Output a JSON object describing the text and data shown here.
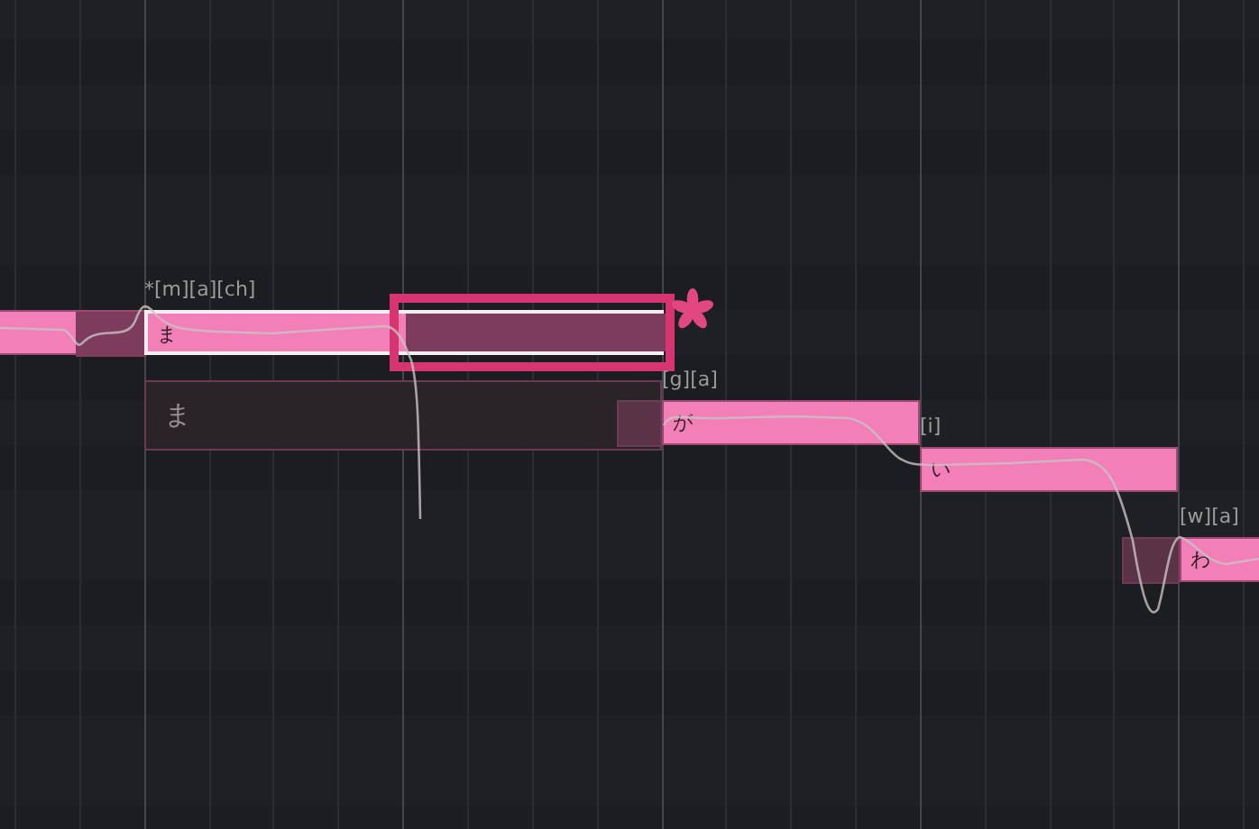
{
  "notes": [
    {
      "selected": false
    },
    {
      "lyric": "ま",
      "phonemes": "*[m][a][ch]",
      "selected": true
    },
    {
      "lyric": "が",
      "phonemes": "[g][a]",
      "selected": false
    },
    {
      "lyric": "い",
      "phonemes": "[i]",
      "selected": false
    },
    {
      "lyric": "わ",
      "phonemes": "[w][a]",
      "selected": false
    }
  ],
  "ghost_note": {
    "lyric": "ま"
  }
}
